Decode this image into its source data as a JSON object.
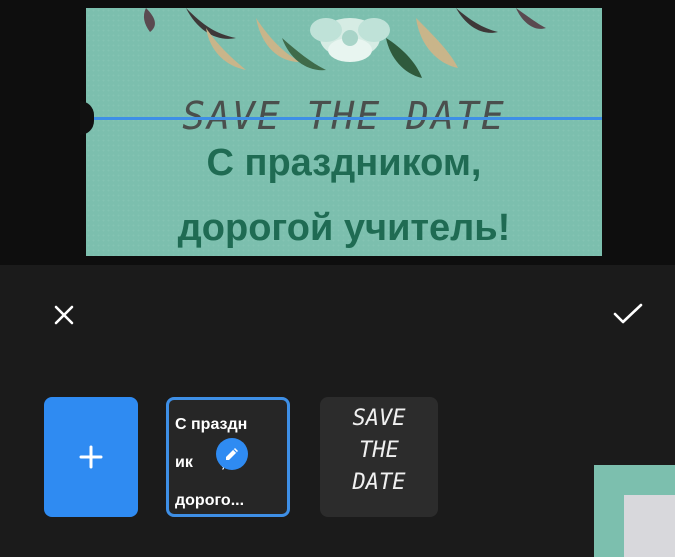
{
  "canvas": {
    "card_title": "SAVE THE DATE",
    "greeting_line1": "С праздником,",
    "greeting_line2": "дорогой учитель!",
    "card_color": "#7cbfae",
    "guide_color": "#3e8fe6"
  },
  "toolbar": {
    "close_icon": "close-icon",
    "confirm_icon": "checkmark-icon"
  },
  "text_items": {
    "add_icon": "plus-icon",
    "items": [
      {
        "line1": "С праздн",
        "line2": "ик",
        "line2_suffix": ",",
        "line3": "дорого...",
        "selected": true,
        "edit_icon": "pencil-icon"
      },
      {
        "line1": "SAVE",
        "line2": "THE",
        "line3": "DATE",
        "selected": false
      }
    ],
    "accent_color": "#2f8bf2"
  }
}
